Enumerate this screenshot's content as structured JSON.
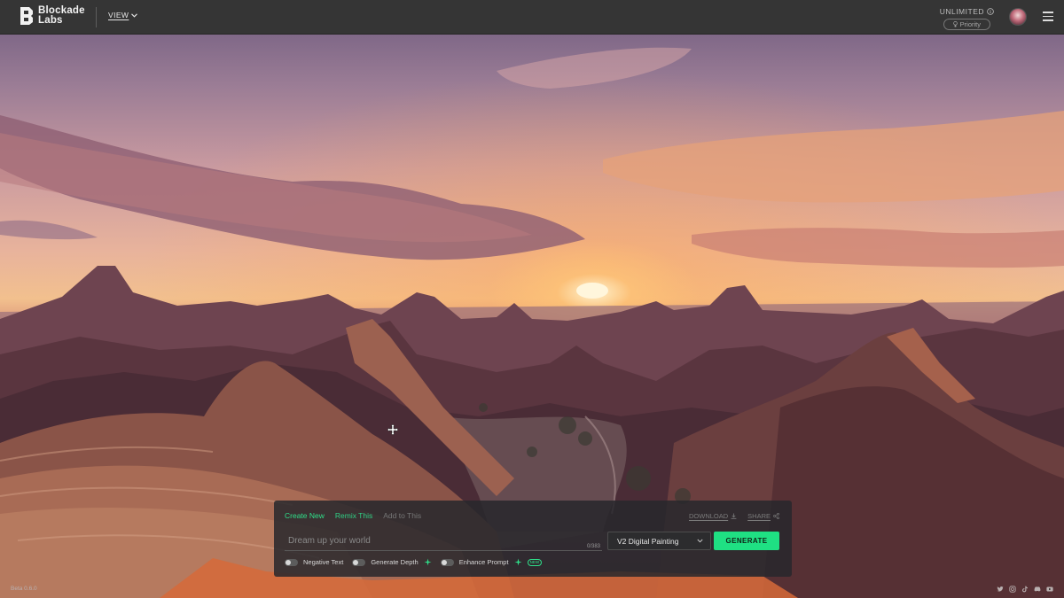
{
  "brand": {
    "name_line1": "Blockade",
    "name_line2": "Labs"
  },
  "header": {
    "view_label": "VIEW",
    "plan_label": "UNLIMITED",
    "priority_label": "Priority"
  },
  "panel": {
    "tabs": [
      {
        "label": "Create New"
      },
      {
        "label": "Remix This"
      },
      {
        "label": "Add to This"
      }
    ],
    "download_label": "DOWNLOAD",
    "share_label": "SHARE",
    "prompt_placeholder": "Dream up your world",
    "prompt_value": "",
    "char_count": "0/383",
    "style_selected": "V2 Digital Painting",
    "generate_label": "GENERATE",
    "toggles": [
      {
        "label": "Negative Text",
        "on": false
      },
      {
        "label": "Generate Depth",
        "on": false
      },
      {
        "label": "Enhance Prompt",
        "on": false
      }
    ],
    "new_badge": "NEW"
  },
  "footer": {
    "version": "Beta 0.6.0",
    "social_icons": [
      "twitter-icon",
      "instagram-icon",
      "tiktok-icon",
      "discord-icon",
      "youtube-icon"
    ]
  },
  "colors": {
    "accent": "#1fe083",
    "topbar": "#353535",
    "panel": "#28282c"
  }
}
